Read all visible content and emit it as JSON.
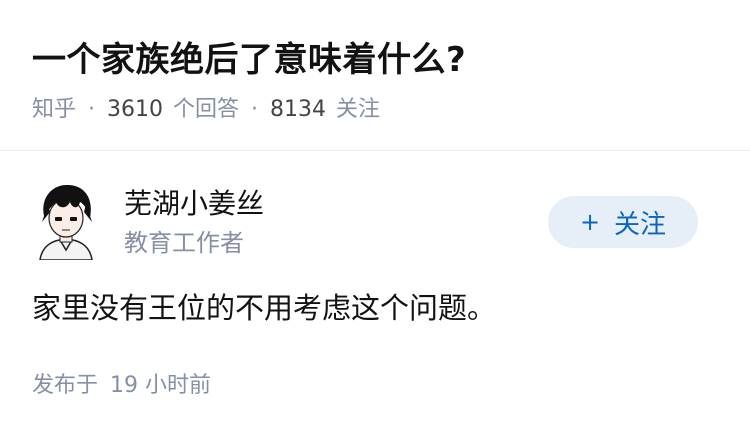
{
  "question": {
    "title": "一个家族绝后了意味着什么?",
    "source": "知乎",
    "answers_count": "3610",
    "answers_label": "个回答",
    "followers_count": "8134",
    "followers_label": "关注",
    "separator": "·"
  },
  "author": {
    "name": "芜湖小姜丝",
    "bio": "教育工作者",
    "avatar_icon": "avatar-icon",
    "follow_plus": "+",
    "follow_label": "关注"
  },
  "answer": {
    "content": "家里没有王位的不用考虑这个问题。",
    "published_label": "发布于",
    "published_num": "19",
    "published_unit": "小时前"
  },
  "colors": {
    "meta_gray": "#8590a6",
    "follow_bg": "#e6eef7",
    "follow_text": "#0a66c2",
    "divider": "#ebebeb"
  }
}
